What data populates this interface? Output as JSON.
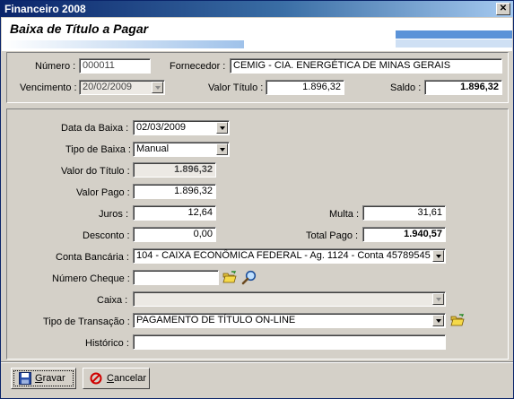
{
  "window": {
    "title": "Financeiro 2008",
    "close_glyph": "✕"
  },
  "header": {
    "title": "Baixa de Título a Pagar"
  },
  "info": {
    "numero_label": "Número :",
    "numero_value": "000011",
    "fornecedor_label": "Fornecedor :",
    "fornecedor_value": "CEMIG - CIA. ENERGÉTICA DE MINAS GERAIS",
    "vencimento_label": "Vencimento :",
    "vencimento_value": "20/02/2009",
    "valor_titulo_label": "Valor Título :",
    "valor_titulo_value": "1.896,32",
    "saldo_label": "Saldo :",
    "saldo_value": "1.896,32"
  },
  "form": {
    "data_baixa_label": "Data da Baixa :",
    "data_baixa_value": "02/03/2009",
    "tipo_baixa_label": "Tipo de Baixa :",
    "tipo_baixa_value": "Manual",
    "valor_titulo_label": "Valor do Título :",
    "valor_titulo_value": "1.896,32",
    "valor_pago_label": "Valor Pago :",
    "valor_pago_value": "1.896,32",
    "juros_label": "Juros :",
    "juros_value": "12,64",
    "multa_label": "Multa :",
    "multa_value": "31,61",
    "desconto_label": "Desconto :",
    "desconto_value": "0,00",
    "total_pago_label": "Total Pago :",
    "total_pago_value": "1.940,57",
    "conta_label": "Conta Bancária :",
    "conta_value": "104 - CAIXA ECONÔMICA FEDERAL - Ag. 1124 - Conta 45789545",
    "cheque_label": "Número Cheque :",
    "cheque_value": "",
    "caixa_label": "Caixa :",
    "caixa_value": "",
    "transacao_label": "Tipo de Transação :",
    "transacao_value": "PAGAMENTO DE TÍTULO ON-LINE",
    "historico_label": "Histórico :",
    "historico_value": ""
  },
  "buttons": {
    "gravar_first": "G",
    "gravar_rest": "ravar",
    "cancelar_first": "C",
    "cancelar_rest": "ancelar"
  },
  "icons": [
    "folder-open-icon",
    "magnifier-icon",
    "floppy-disk-icon",
    "cancel-icon"
  ],
  "colors": {
    "title_bar": "#0a246a",
    "accent_blue": "#5b93d8",
    "cancel_red": "#d00000"
  }
}
